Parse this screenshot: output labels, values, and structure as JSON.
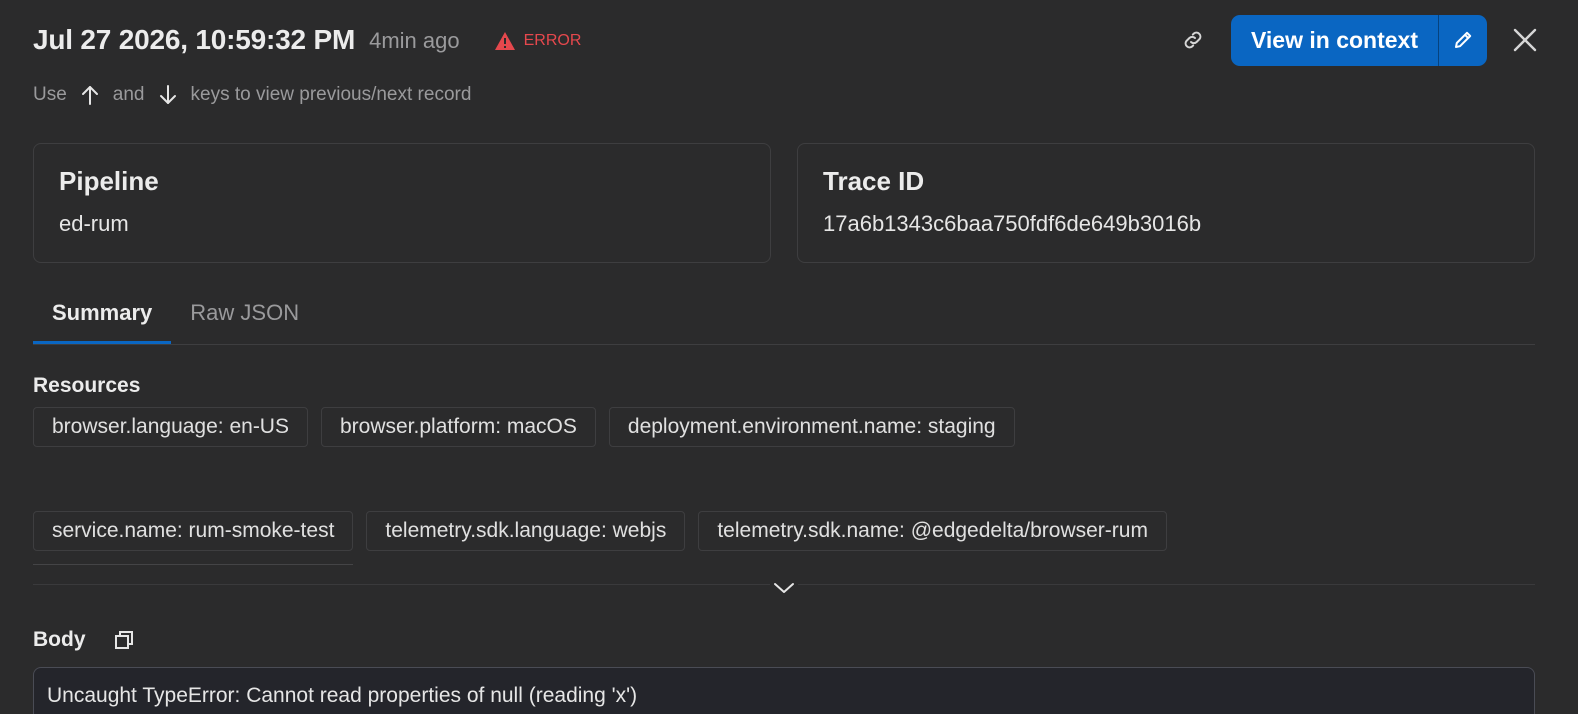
{
  "header": {
    "timestamp": "Jul 27 2026, 10:59:32 PM",
    "relative_time": "4min ago",
    "level": "ERROR",
    "view_in_context_label": "View in context"
  },
  "hint": {
    "use": "Use",
    "and": "and",
    "rest": "keys to view previous/next record"
  },
  "cards": {
    "pipeline": {
      "title": "Pipeline",
      "value": "ed-rum"
    },
    "trace": {
      "title": "Trace ID",
      "value": "17a6b1343c6baa750fdf6de649b3016b"
    }
  },
  "tabs": [
    {
      "label": "Summary",
      "active": true
    },
    {
      "label": "Raw JSON",
      "active": false
    }
  ],
  "resources": {
    "title": "Resources",
    "row1": [
      "browser.language: en-US",
      "browser.platform: macOS",
      "deployment.environment.name: staging"
    ],
    "row2": [
      "service.name: rum-smoke-test",
      "telemetry.sdk.language: webjs",
      "telemetry.sdk.name: @edgedelta/browser-rum"
    ]
  },
  "body": {
    "title": "Body",
    "text": "Uncaught TypeError: Cannot read properties of null (reading 'x')"
  },
  "colors": {
    "background": "#2b2b2c",
    "accent": "#0a66c2",
    "error": "#e5484d"
  }
}
